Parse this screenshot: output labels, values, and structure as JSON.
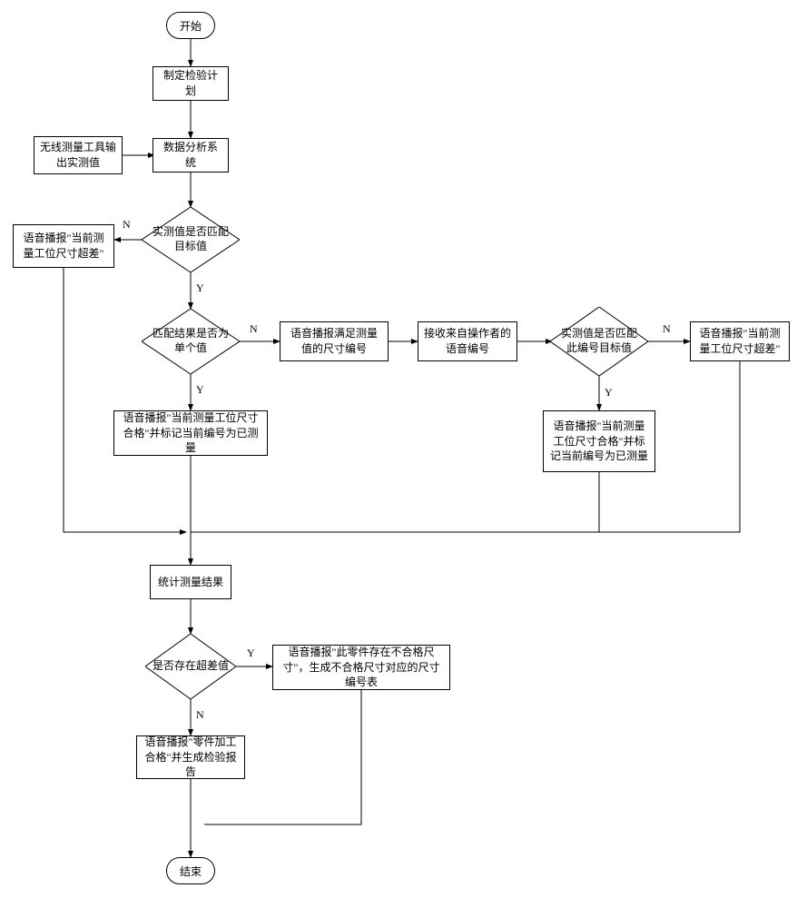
{
  "chart_data": {
    "type": "flowchart",
    "title": "",
    "nodes": [
      {
        "id": "start",
        "type": "terminator",
        "text": "开始"
      },
      {
        "id": "n1",
        "type": "process",
        "text": "制定检验计划"
      },
      {
        "id": "n2",
        "type": "process",
        "text": "无线测量工具输出实测值"
      },
      {
        "id": "n3",
        "type": "process",
        "text": "数据分析系统"
      },
      {
        "id": "d1",
        "type": "decision",
        "text": "实测值是否匹配目标值"
      },
      {
        "id": "n4",
        "type": "process",
        "text": "语音播报\"当前测量工位尺寸超差\""
      },
      {
        "id": "d2",
        "type": "decision",
        "text": "匹配结果是否为单个值"
      },
      {
        "id": "n5",
        "type": "process",
        "text": "语音播报满足测量值的尺寸编号"
      },
      {
        "id": "n6",
        "type": "process",
        "text": "接收来自操作者的语音编号"
      },
      {
        "id": "d3",
        "type": "decision",
        "text": "实测值是否匹配此编号目标值"
      },
      {
        "id": "n7",
        "type": "process",
        "text": "语音播报\"当前测量工位尺寸超差\""
      },
      {
        "id": "n8",
        "type": "process",
        "text": "语音播报\"当前测量工位尺寸合格\"并标记当前编号为已测量"
      },
      {
        "id": "n9",
        "type": "process",
        "text": "语音播报\"当前测量工位尺寸合格\"并标记当前编号为已测量"
      },
      {
        "id": "n10",
        "type": "process",
        "text": "统计测量结果"
      },
      {
        "id": "d4",
        "type": "decision",
        "text": "是否存在超差值"
      },
      {
        "id": "n11",
        "type": "process",
        "text": "语音播报\"此零件存在不合格尺寸\"，生成不合格尺寸对应的尺寸编号表"
      },
      {
        "id": "n12",
        "type": "process",
        "text": "语音播报\"零件加工合格\"并生成检验报告"
      },
      {
        "id": "end",
        "type": "terminator",
        "text": "结束"
      }
    ],
    "edges": [
      {
        "from": "start",
        "to": "n1"
      },
      {
        "from": "n1",
        "to": "n3"
      },
      {
        "from": "n2",
        "to": "n3"
      },
      {
        "from": "n3",
        "to": "d1"
      },
      {
        "from": "d1",
        "to": "n4",
        "label": "N"
      },
      {
        "from": "d1",
        "to": "d2",
        "label": "Y"
      },
      {
        "from": "d2",
        "to": "n5",
        "label": "N"
      },
      {
        "from": "d2",
        "to": "n8",
        "label": "Y"
      },
      {
        "from": "n5",
        "to": "n6"
      },
      {
        "from": "n6",
        "to": "d3"
      },
      {
        "from": "d3",
        "to": "n7",
        "label": "N"
      },
      {
        "from": "d3",
        "to": "n9",
        "label": "Y"
      },
      {
        "from": "n4",
        "to": "n10"
      },
      {
        "from": "n8",
        "to": "n10"
      },
      {
        "from": "n9",
        "to": "n10"
      },
      {
        "from": "n7",
        "to": "n10"
      },
      {
        "from": "n10",
        "to": "d4"
      },
      {
        "from": "d4",
        "to": "n11",
        "label": "Y"
      },
      {
        "from": "d4",
        "to": "n12",
        "label": "N"
      },
      {
        "from": "n11",
        "to": "end"
      },
      {
        "from": "n12",
        "to": "end"
      },
      {
        "from": "end",
        "to": null
      }
    ],
    "edge_labels": {
      "Y": "Y",
      "N": "N"
    }
  }
}
